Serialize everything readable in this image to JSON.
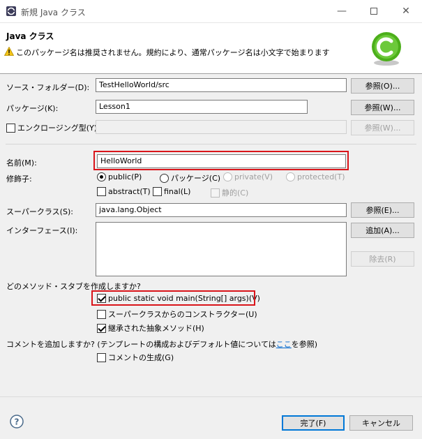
{
  "window": {
    "title": "新規 Java クラス"
  },
  "header": {
    "title": "Java クラス",
    "warning": "このパッケージ名は推奨されません。規約により、通常パッケージ名は小文字で始まります"
  },
  "form": {
    "source_folder": {
      "label": "ソース・フォルダー(D):",
      "value": "TestHelloWorld/src",
      "button": "参照(O)..."
    },
    "package": {
      "label": "パッケージ(K):",
      "value": "Lesson1",
      "button": "参照(W)..."
    },
    "enclosing": {
      "label": "エンクロージング型(Y):",
      "checked": false,
      "value": "",
      "button": "参照(W)..."
    },
    "name": {
      "label": "名前(M):",
      "value": "HelloWorld"
    },
    "modifiers": {
      "label": "修飾子:",
      "public": "public(P)",
      "package": "パッケージ(C)",
      "private": "private(V)",
      "protected": "protected(T)",
      "abstract": "abstract(T)",
      "final": "final(L)",
      "static": "静的(C)"
    },
    "superclass": {
      "label": "スーパークラス(S):",
      "value": "java.lang.Object",
      "button": "参照(E)..."
    },
    "interfaces": {
      "label": "インターフェース(I):",
      "add_button": "追加(A)...",
      "remove_button": "除去(R)"
    },
    "stubs": {
      "question": "どのメソッド・スタブを作成しますか?",
      "main": "public static void main(String[] args)(V)",
      "constructors": "スーパークラスからのコンストラクター(U)",
      "inherited": "継承された抽象メソッド(H)"
    },
    "comments": {
      "question_prefix": "コメントを追加しますか? (テンプレートの構成およびデフォルト値については",
      "link": "ここ",
      "question_suffix": "を参照)",
      "generate": "コメントの生成(G)"
    }
  },
  "footer": {
    "finish": "完了(F)",
    "cancel": "キャンセル"
  },
  "colors": {
    "highlight": "#d9141a",
    "accent": "#0078d7",
    "logo": "#4caf1a"
  }
}
